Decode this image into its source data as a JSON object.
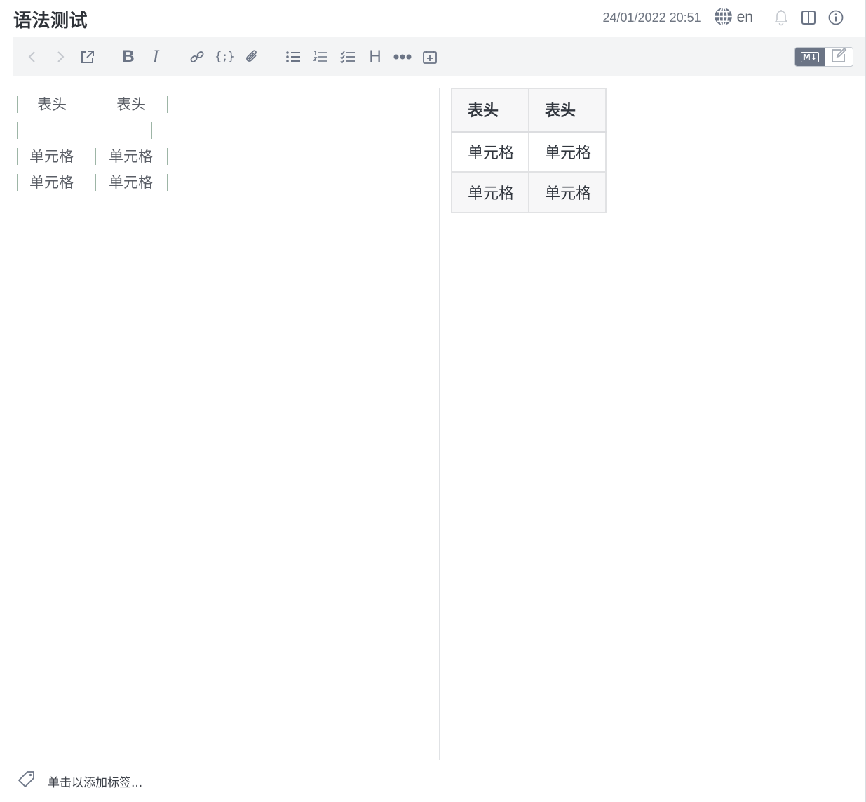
{
  "header": {
    "title": "语法测试",
    "datetime": "24/01/2022 20:51",
    "language": "en"
  },
  "toolbar": {
    "bold_label": "B",
    "italic_label": "I",
    "code_label": "{;}",
    "heading_label": "H",
    "mode_markdown_label": "M↓"
  },
  "editor": {
    "markdown_lines": [
      [
        "表头",
        "表头"
      ],
      [
        "----",
        "----"
      ],
      [
        "单元格",
        "单元格"
      ],
      [
        "单元格",
        "单元格"
      ]
    ]
  },
  "preview": {
    "headers": [
      "表头",
      "表头"
    ],
    "rows": [
      [
        "单元格",
        "单元格"
      ],
      [
        "单元格",
        "单元格"
      ]
    ]
  },
  "footer": {
    "tag_placeholder": "单击以添加标签..."
  },
  "colors": {
    "toolbar_bg": "#f3f4f5",
    "icon": "#6b7485",
    "pipe": "#9db5a6",
    "border": "#e1e2e4"
  }
}
